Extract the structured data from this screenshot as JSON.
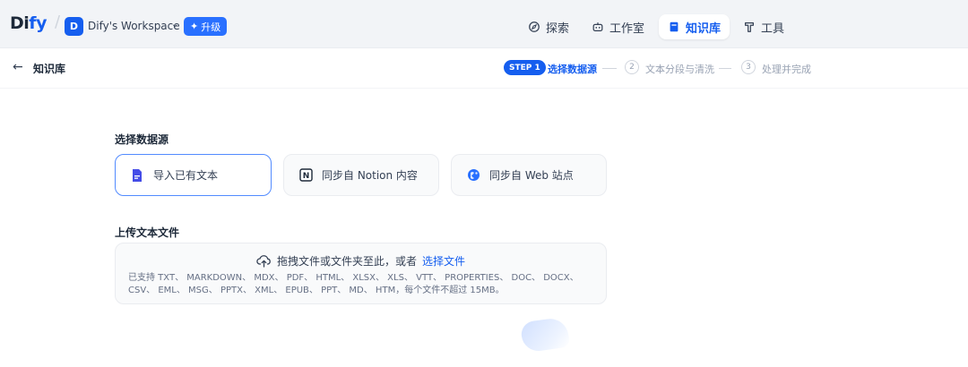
{
  "topbar": {
    "logo_main": "Di",
    "logo_accent": "fy",
    "workspace_initial": "D",
    "workspace_name": "Dify's Workspace",
    "upgrade_label": "升级",
    "nav": [
      {
        "label": "探索",
        "icon": "compass-icon"
      },
      {
        "label": "工作室",
        "icon": "robot-icon"
      },
      {
        "label": "知识库",
        "icon": "book-icon",
        "active": true
      },
      {
        "label": "工具",
        "icon": "hammer-icon"
      }
    ]
  },
  "subheader": {
    "back_label": "知识库",
    "steps": [
      {
        "badge": "STEP 1",
        "label": "选择数据源",
        "active": true
      },
      {
        "number": "2",
        "label": "文本分段与清洗"
      },
      {
        "number": "3",
        "label": "处理并完成"
      }
    ]
  },
  "datasource": {
    "title": "选择数据源",
    "options": [
      {
        "label": "导入已有文本",
        "icon": "file-text-icon",
        "selected": true
      },
      {
        "label": "同步自 Notion 内容",
        "icon": "notion-icon"
      },
      {
        "label": "同步自 Web 站点",
        "icon": "globe-icon"
      }
    ]
  },
  "upload": {
    "title": "上传文本文件",
    "drop_text": "拖拽文件或文件夹至此，或者",
    "choose_link": "选择文件",
    "tip": "已支持 TXT、 MARKDOWN、 MDX、 PDF、 HTML、 XLSX、 XLS、 VTT、 PROPERTIES、 DOC、 DOCX、 CSV、 EML、 MSG、 PPTX、 XML、 EPUB、 PPT、 MD、 HTM，每个文件不超过 15MB。"
  },
  "colors": {
    "accent": "#155eef",
    "topbar_bg": "#f2f4f7",
    "card_bg": "#f9fafb"
  }
}
